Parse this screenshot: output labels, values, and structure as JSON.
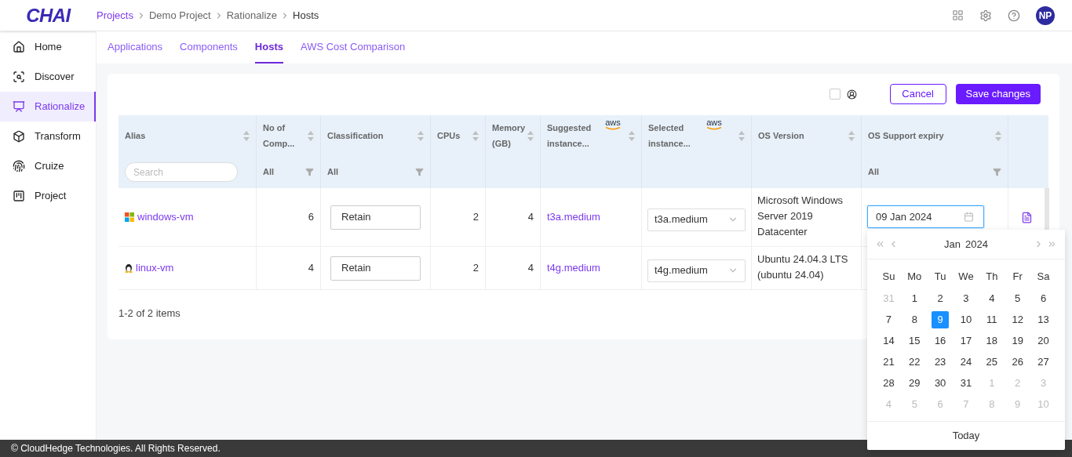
{
  "header": {
    "logo": "CHAI",
    "breadcrumbs": [
      "Projects",
      "Demo Project",
      "Rationalize",
      "Hosts"
    ],
    "avatar": "NP"
  },
  "sidebar": {
    "items": [
      {
        "label": "Home",
        "selected": false
      },
      {
        "label": "Discover",
        "selected": false
      },
      {
        "label": "Rationalize",
        "selected": true
      },
      {
        "label": "Transform",
        "selected": false
      },
      {
        "label": "Cruize",
        "selected": false
      },
      {
        "label": "Project",
        "selected": false
      }
    ]
  },
  "tabs": [
    {
      "label": "Applications",
      "selected": false
    },
    {
      "label": "Components",
      "selected": false
    },
    {
      "label": "Hosts",
      "selected": true
    },
    {
      "label": "AWS Cost Comparison",
      "selected": false
    }
  ],
  "toolbar": {
    "checked": false,
    "buttons": [
      {
        "label": "Cancel",
        "kind": "outline"
      },
      {
        "label": "Save changes",
        "kind": "primary"
      }
    ]
  },
  "table": {
    "columns": [
      {
        "label": "Alias",
        "filter": {
          "kind": "search",
          "placeholder": "Search"
        }
      },
      {
        "label": "No of Comp...",
        "filter": {
          "kind": "select",
          "value": "All"
        }
      },
      {
        "label": "Classification",
        "filter": {
          "kind": "select",
          "value": "All"
        }
      },
      {
        "label": "CPUs"
      },
      {
        "label": "Memory (GB)"
      },
      {
        "label": "Suggested instance...",
        "aws": "aws"
      },
      {
        "label": "Selected instance...",
        "aws": "aws"
      },
      {
        "label": "OS Version"
      },
      {
        "label": "OS Support expiry",
        "filter": {
          "kind": "select",
          "value": "All"
        }
      }
    ],
    "rows": [
      {
        "kind": "windows",
        "alias": "windows-vm",
        "components": "6",
        "classification": "Retain",
        "cpus": "2",
        "memory": "4",
        "suggested": "t3a.medium",
        "selected_instance": "t3a.medium",
        "os_version": "Microsoft Windows Server 2019 Datacenter",
        "expiry": "09 Jan 2024"
      },
      {
        "kind": "linux",
        "alias": "linux-vm",
        "components": "4",
        "classification": "Retain",
        "cpus": "2",
        "memory": "4",
        "suggested": "t4g.medium",
        "selected_instance": "t4g.medium",
        "os_version": "Ubuntu 24.04.3 LTS (ubuntu 24.04)"
      }
    ],
    "pagination": "1-2 of 2 items"
  },
  "calendar": {
    "month": "Jan",
    "year": "2024",
    "weekdays": [
      "Su",
      "Mo",
      "Tu",
      "We",
      "Th",
      "Fr",
      "Sa"
    ],
    "days": [
      {
        "d": "31",
        "muted": true,
        "selected": false
      },
      {
        "d": "1",
        "muted": false,
        "selected": false
      },
      {
        "d": "2",
        "muted": false,
        "selected": false
      },
      {
        "d": "3",
        "muted": false,
        "selected": false
      },
      {
        "d": "4",
        "muted": false,
        "selected": false
      },
      {
        "d": "5",
        "muted": false,
        "selected": false
      },
      {
        "d": "6",
        "muted": false,
        "selected": false
      },
      {
        "d": "7",
        "muted": false,
        "selected": false
      },
      {
        "d": "8",
        "muted": false,
        "selected": false
      },
      {
        "d": "9",
        "muted": false,
        "selected": true
      },
      {
        "d": "10",
        "muted": false,
        "selected": false
      },
      {
        "d": "11",
        "muted": false,
        "selected": false
      },
      {
        "d": "12",
        "muted": false,
        "selected": false
      },
      {
        "d": "13",
        "muted": false,
        "selected": false
      },
      {
        "d": "14",
        "muted": false,
        "selected": false
      },
      {
        "d": "15",
        "muted": false,
        "selected": false
      },
      {
        "d": "16",
        "muted": false,
        "selected": false
      },
      {
        "d": "17",
        "muted": false,
        "selected": false
      },
      {
        "d": "18",
        "muted": false,
        "selected": false
      },
      {
        "d": "19",
        "muted": false,
        "selected": false
      },
      {
        "d": "20",
        "muted": false,
        "selected": false
      },
      {
        "d": "21",
        "muted": false,
        "selected": false
      },
      {
        "d": "22",
        "muted": false,
        "selected": false
      },
      {
        "d": "23",
        "muted": false,
        "selected": false
      },
      {
        "d": "24",
        "muted": false,
        "selected": false
      },
      {
        "d": "25",
        "muted": false,
        "selected": false
      },
      {
        "d": "26",
        "muted": false,
        "selected": false
      },
      {
        "d": "27",
        "muted": false,
        "selected": false
      },
      {
        "d": "28",
        "muted": false,
        "selected": false
      },
      {
        "d": "29",
        "muted": false,
        "selected": false
      },
      {
        "d": "30",
        "muted": false,
        "selected": false
      },
      {
        "d": "31",
        "muted": false,
        "selected": false
      },
      {
        "d": "1",
        "muted": true,
        "selected": false
      },
      {
        "d": "2",
        "muted": true,
        "selected": false
      },
      {
        "d": "3",
        "muted": true,
        "selected": false
      },
      {
        "d": "4",
        "muted": true,
        "selected": false
      },
      {
        "d": "5",
        "muted": true,
        "selected": false
      },
      {
        "d": "6",
        "muted": true,
        "selected": false
      },
      {
        "d": "7",
        "muted": true,
        "selected": false
      },
      {
        "d": "8",
        "muted": true,
        "selected": false
      },
      {
        "d": "9",
        "muted": true,
        "selected": false
      },
      {
        "d": "10",
        "muted": true,
        "selected": false
      }
    ],
    "today": "Today"
  },
  "footer": {
    "copyright": "© CloudHedge Technologies. All Rights Reserved."
  }
}
